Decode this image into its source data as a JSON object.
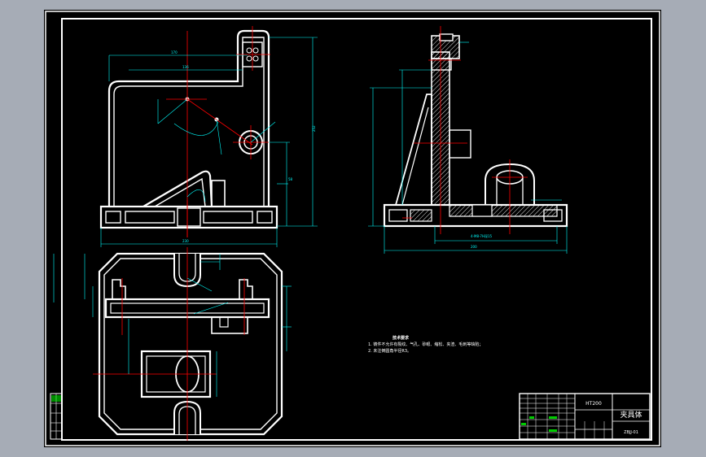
{
  "drawing": {
    "title": "夹具体",
    "drawing_number": "ZBJJ-01",
    "title_block_header": "HT200",
    "technical_requirements": {
      "heading": "技术要求",
      "items": [
        "1. 铸件不允许有裂纹、气孔、砂眼、缩松、夹渣、毛刺等缺陷；",
        "2. 未注倒圆角半径R3。"
      ]
    },
    "dimension_note": "4-M8-7H深15"
  },
  "colors": {
    "background": "#000000",
    "outline": "#ffffff",
    "dimension": "#00ffff",
    "centerline": "#ff0000",
    "hatch": "#ffffff",
    "title_block_text": "#00ff00",
    "frame_bg": "#a6acb6"
  }
}
